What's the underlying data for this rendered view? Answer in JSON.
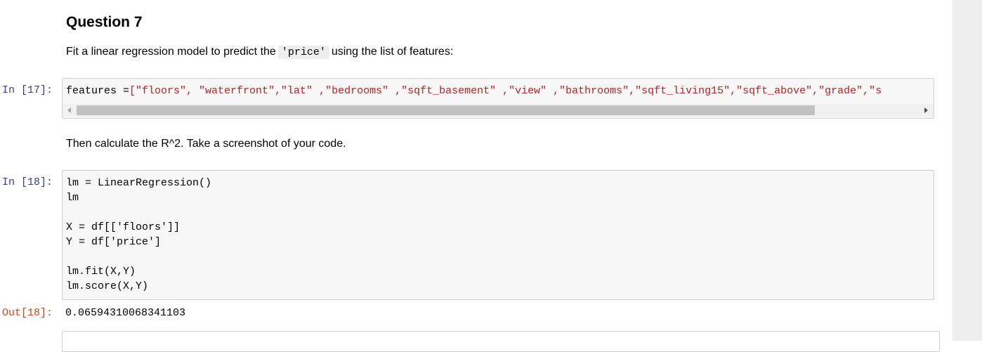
{
  "markdown": {
    "title": "Question 7",
    "line1_before": "Fit a linear regression model to predict the",
    "line1_code": "'price'",
    "line1_after": "using the list of features:",
    "line2": "Then calculate the R^2. Take a screenshot of your code."
  },
  "cell17": {
    "prompt": "In [17]:",
    "code_prefix": "features =",
    "code_rest": "[\"floors\", \"waterfront\",\"lat\" ,\"bedrooms\" ,\"sqft_basement\" ,\"view\" ,\"bathrooms\",\"sqft_living15\",\"sqft_above\",\"grade\",\"s"
  },
  "cell18": {
    "prompt": "In [18]:",
    "lines": [
      "lm = LinearRegression()",
      "lm",
      "",
      "X = df[['floors']]",
      "Y = df['price']",
      "",
      "lm.fit(X,Y)",
      "lm.score(X,Y)"
    ],
    "out_prompt": "Out[18]:",
    "output": "0.06594310068341103"
  }
}
